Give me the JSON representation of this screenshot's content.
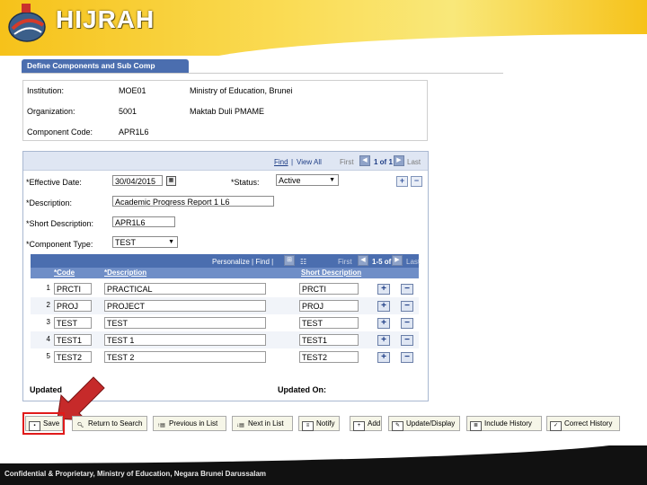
{
  "header": {
    "logo_text": "HIJRAH"
  },
  "page_tab": "Define Components and Sub Comp",
  "info": {
    "rows": [
      {
        "label": "Institution:",
        "value": "MOE01",
        "desc": "Ministry of Education, Brunei"
      },
      {
        "label": "Organization:",
        "value": "5001",
        "desc": "Maktab Duli PMAME"
      },
      {
        "label": "Component Code:",
        "value": "APR1L6",
        "desc": ""
      }
    ]
  },
  "nav": {
    "find": "Find",
    "sep": "|",
    "view_all": "View All",
    "first": "First",
    "count": "1 of 1",
    "last": "Last"
  },
  "form": {
    "effective_date_label": "*Effective Date:",
    "effective_date": "30/04/2015",
    "status_label": "*Status:",
    "status": "Active",
    "description_label": "*Description:",
    "description": "Academic Progress Report 1 L6",
    "short_desc_label": "*Short Description:",
    "short_desc": "APR1L6",
    "component_type_label": "*Component Type:",
    "component_type": "TEST"
  },
  "grid": {
    "personalize": "Personalize | Find |",
    "first": "First",
    "count": "1-5 of 5",
    "last": "Last",
    "headers": {
      "code": "*Code",
      "description": "*Description",
      "short": "Short Description"
    },
    "rows": [
      {
        "num": "1",
        "code": "PRCTI",
        "description": "PRACTICAL",
        "short": "PRCTI"
      },
      {
        "num": "2",
        "code": "PROJ",
        "description": "PROJECT",
        "short": "PROJ"
      },
      {
        "num": "3",
        "code": "TEST",
        "description": "TEST",
        "short": "TEST"
      },
      {
        "num": "4",
        "code": "TEST1",
        "description": "TEST 1",
        "short": "TEST1"
      },
      {
        "num": "5",
        "code": "TEST2",
        "description": "TEST 2",
        "short": "TEST2"
      }
    ]
  },
  "updated_by_label": "Updated",
  "updated_on_label": "Updated On:",
  "toolbar": {
    "save": "Save",
    "return_to_search": "Return to Search",
    "previous_in_list": "Previous in List",
    "next_in_list": "Next in List",
    "notify": "Notify",
    "add": "Add",
    "update_display": "Update/Display",
    "include_history": "Include History",
    "correct_history": "Correct History"
  },
  "footer": {
    "text": "Confidential & Proprietary, Ministry of Education, Negara Brunei Darussalam"
  },
  "colors": {
    "header_gold": "#f6c21a",
    "tab_blue": "#4b6eaf",
    "highlight_red": "#e01a1a"
  }
}
